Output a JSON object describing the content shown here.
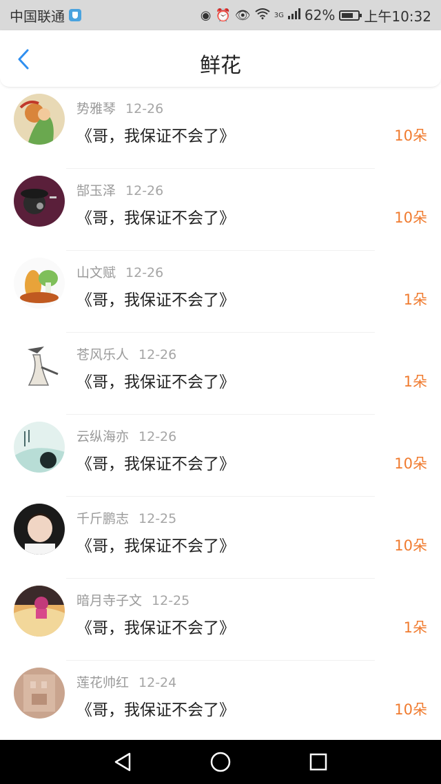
{
  "status_bar": {
    "carrier": "中国联通",
    "battery": "62%",
    "time": "上午10:32",
    "net": "3G"
  },
  "header": {
    "title": "鲜花"
  },
  "records": [
    {
      "user": "势雅琴",
      "date": "12-26",
      "book": "《哥，我保证不会了》",
      "count": "10朵"
    },
    {
      "user": "郜玉泽",
      "date": "12-26",
      "book": "《哥，我保证不会了》",
      "count": "10朵"
    },
    {
      "user": "山文赋",
      "date": "12-26",
      "book": "《哥，我保证不会了》",
      "count": "1朵"
    },
    {
      "user": "苍风乐人",
      "date": "12-26",
      "book": "《哥，我保证不会了》",
      "count": "1朵"
    },
    {
      "user": "云纵海亦",
      "date": "12-26",
      "book": "《哥，我保证不会了》",
      "count": "10朵"
    },
    {
      "user": "千斤鹏志",
      "date": "12-25",
      "book": "《哥，我保证不会了》",
      "count": "10朵"
    },
    {
      "user": "暗月寺子文",
      "date": "12-25",
      "book": "《哥，我保证不会了》",
      "count": "1朵"
    },
    {
      "user": "莲花帅红",
      "date": "12-24",
      "book": "《哥，我保证不会了》",
      "count": "10朵"
    }
  ],
  "colors": {
    "accent_blue": "#2f8ff0",
    "count_orange": "#f07b2f"
  }
}
